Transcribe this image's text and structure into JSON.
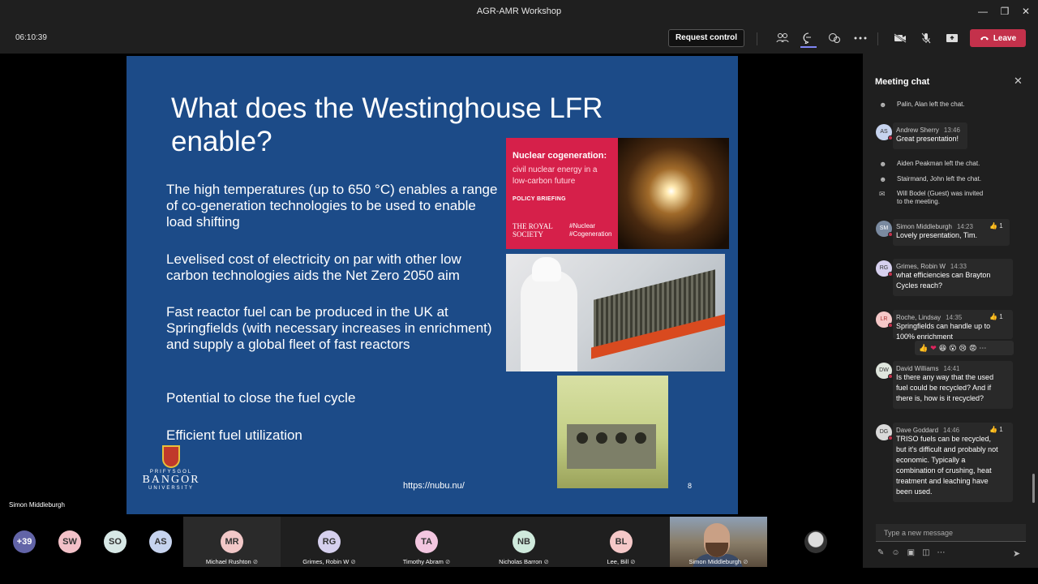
{
  "window": {
    "title": "AGR-AMR Workshop"
  },
  "toolbar": {
    "timer": "06:10:39",
    "request_control_label": "Request control",
    "leave_label": "Leave"
  },
  "slide": {
    "title": "What does the Westinghouse LFR enable?",
    "bullets": [
      "The high temperatures (up to 650 °C) enables a range of co-generation technologies to be used to enable load shifting",
      "Levelised cost of electricity on par with other low carbon technologies aids the Net Zero 2050 aim",
      "Fast reactor fuel can be produced in the UK at Springfields (with necessary increases in enrichment) and supply a global fleet of fast reactors",
      "Potential to close the fuel cycle",
      "Efficient fuel utilization"
    ],
    "url": "https://nubu.nu/",
    "page_number": "8",
    "logo": {
      "prefix": "PRIFYSGOL",
      "name": "BANGOR",
      "suffix": "UNIVERSITY"
    },
    "royal_society_image": {
      "title": "Nuclear cogeneration:",
      "subtitle": "civil nuclear energy in a low-carbon future",
      "label": "POLICY BRIEFING",
      "society": "THE ROYAL SOCIETY",
      "tags": "#Nuclear #Cogeneration"
    }
  },
  "presenter_label": "Simon Middleburgh",
  "chat": {
    "title": "Meeting chat",
    "system_messages": [
      "Palin, Alan left the chat.",
      "Aiden Peakman left the chat.",
      "Stairmand, John left the chat.",
      "Will Bodel (Guest) was invited to the meeting."
    ],
    "messages": [
      {
        "initials": "AS",
        "author": "Andrew Sherry",
        "time": "13:46",
        "text": "Great presentation!",
        "likes": ""
      },
      {
        "initials": "SM",
        "author": "Simon Middleburgh",
        "time": "14:23",
        "text": "Lovely presentation, Tim.",
        "likes": "1"
      },
      {
        "initials": "RG",
        "author": "Grimes, Robin W",
        "time": "14:33",
        "text": "what efficiencies can Brayton Cycles reach?",
        "likes": ""
      },
      {
        "initials": "LR",
        "author": "Roche, Lindsay",
        "time": "14:35",
        "text": "Springfields can handle up to 100% enrichment",
        "likes": "1"
      },
      {
        "initials": "DW",
        "author": "David Williams",
        "time": "14:41",
        "text": "Is there any way that the used fuel could be recycled? And if there is, how is it recycled?",
        "likes": ""
      },
      {
        "initials": "DG",
        "author": "Dave Goddard",
        "time": "14:46",
        "text": "TRISO fuels can be recycled, but it's difficult and probably not economic. Typically a combination of crushing, heat treatment and leaching have been used.",
        "likes": "1"
      }
    ],
    "compose_placeholder": "Type a new message"
  },
  "participants": {
    "overflow": "+39",
    "small_avatars": [
      {
        "initials": "SW",
        "color": "#f3c1c8"
      },
      {
        "initials": "SO",
        "color": "#d7e8e6"
      },
      {
        "initials": "AS",
        "color": "#c6d3ee"
      }
    ],
    "tiles": [
      {
        "initials": "MR",
        "name": "Michael Rushton",
        "color": "#f2c8c8"
      },
      {
        "initials": "RG",
        "name": "Grimes, Robin W",
        "color": "#d6d0ee"
      },
      {
        "initials": "TA",
        "name": "Timothy Abram",
        "color": "#f3c6e0"
      },
      {
        "initials": "NB",
        "name": "Nicholas Barron",
        "color": "#cfeadc"
      },
      {
        "initials": "BL",
        "name": "Lee, Bill",
        "color": "#f5c8c8"
      }
    ],
    "video_name": "Simon Middleburgh"
  },
  "colors": {
    "accent": "#7f85f5",
    "leave": "#c4314b",
    "slide_bg": "#1c4b88"
  }
}
